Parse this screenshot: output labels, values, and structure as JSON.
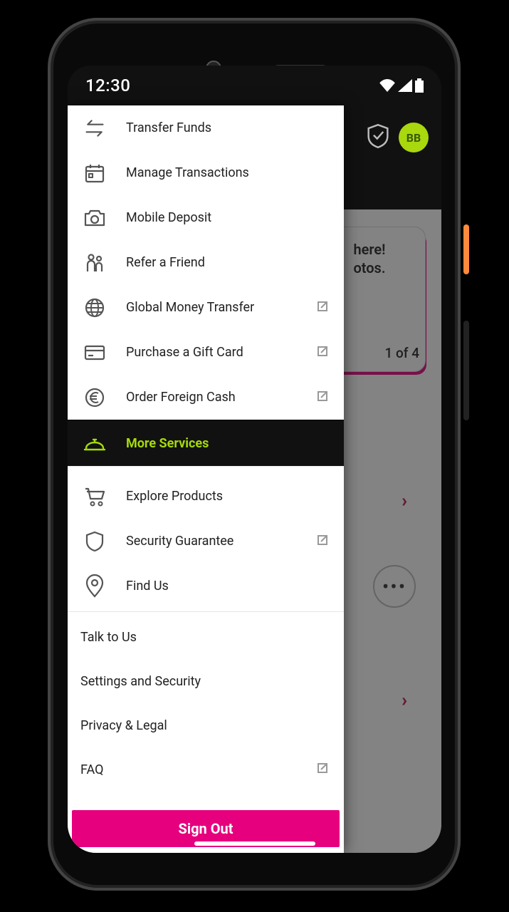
{
  "status": {
    "time": "12:30"
  },
  "topbar": {
    "avatar_initials": "BB"
  },
  "promo": {
    "line1": "here!",
    "line2": "otos.",
    "pager": "1 of 4"
  },
  "drawer": {
    "sections": {
      "a": [
        {
          "key": "transfer-funds",
          "label": "Transfer Funds",
          "ext": false
        },
        {
          "key": "manage-transactions",
          "label": "Manage Transactions",
          "ext": false
        },
        {
          "key": "mobile-deposit",
          "label": "Mobile Deposit",
          "ext": false
        },
        {
          "key": "refer-a-friend",
          "label": "Refer a Friend",
          "ext": false
        },
        {
          "key": "global-money-transfer",
          "label": "Global Money Transfer",
          "ext": true
        },
        {
          "key": "purchase-gift-card",
          "label": "Purchase a Gift Card",
          "ext": true
        },
        {
          "key": "order-foreign-cash",
          "label": "Order Foreign Cash",
          "ext": true
        }
      ],
      "active": {
        "key": "more-services",
        "label": "More Services"
      },
      "b": [
        {
          "key": "explore-products",
          "label": "Explore Products",
          "ext": false
        },
        {
          "key": "security-guarantee",
          "label": "Security Guarantee",
          "ext": true
        },
        {
          "key": "find-us",
          "label": "Find Us",
          "ext": false
        }
      ],
      "c": [
        {
          "key": "talk-to-us",
          "label": "Talk to Us",
          "ext": false
        },
        {
          "key": "settings-and-security",
          "label": "Settings and Security",
          "ext": false
        },
        {
          "key": "privacy-and-legal",
          "label": "Privacy & Legal",
          "ext": false
        },
        {
          "key": "faq",
          "label": "FAQ",
          "ext": true
        }
      ]
    },
    "signout_label": "Sign Out"
  }
}
